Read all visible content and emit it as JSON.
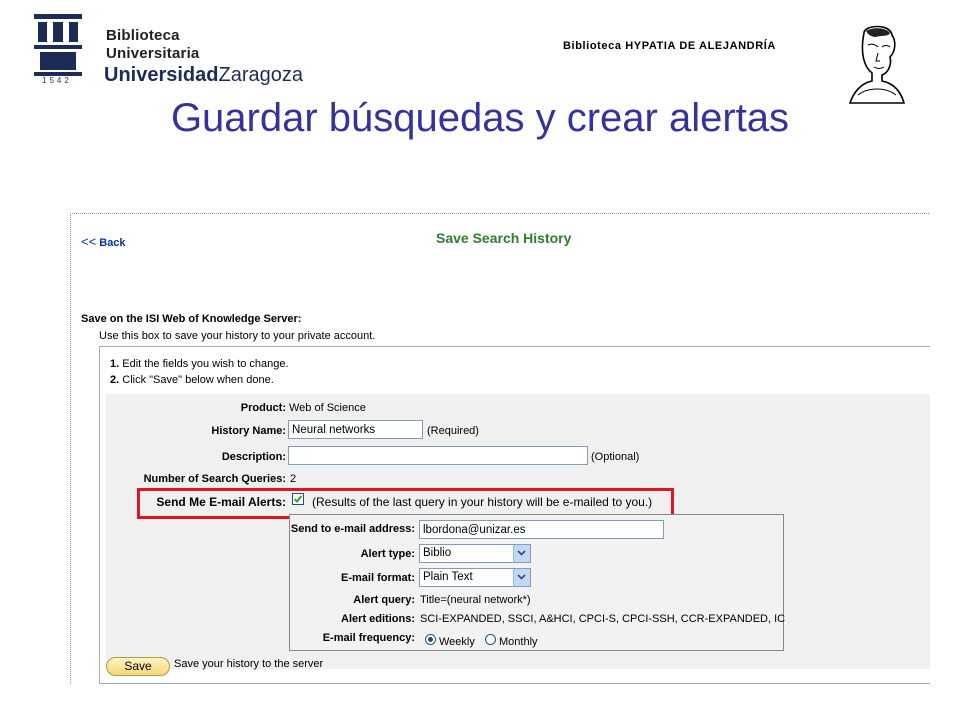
{
  "header": {
    "logo_line1": "Biblioteca",
    "logo_line2": "Universitaria",
    "logo_line3_bold": "Universidad",
    "logo_line3_rest": "Zaragoza",
    "logo_year": "1542",
    "library_name": "Biblioteca HYPATIA DE ALEJANDRÍA",
    "portrait_icon": "hypatia-portrait-icon"
  },
  "slide_title": "Guardar búsquedas y crear alertas",
  "panel": {
    "back_arrows": "<<",
    "back_label": "Back",
    "heading": "Save Search History",
    "save_on_label": "Save on the ISI Web of Knowledge Server:",
    "use_box_text": "Use this box to save your history to your private account.",
    "instruction_1_num": "1.",
    "instruction_1": "Edit the fields you wish to change.",
    "instruction_2_num": "2.",
    "instruction_2": "Click \"Save\" below when done."
  },
  "form": {
    "product_label": "Product:",
    "product_value": "Web of Science",
    "history_name_label": "History Name:",
    "history_name_value": "Neural networks",
    "history_name_note": "(Required)",
    "description_label": "Description:",
    "description_value": "",
    "description_note": "(Optional)",
    "num_queries_label": "Number of Search Queries:",
    "num_queries_value": "2",
    "alerts_label": "Send Me E-mail Alerts:",
    "alerts_checked": true,
    "alerts_note": "(Results of the last query in your history will be e-mailed to you.)"
  },
  "alert": {
    "email_label": "Send to e-mail address:",
    "email_value": "lbordona@unizar.es",
    "type_label": "Alert type:",
    "type_value": "Biblio",
    "format_label": "E-mail format:",
    "format_value": "Plain Text",
    "query_label": "Alert query:",
    "query_value": "Title=(neural network*)",
    "editions_label": "Alert editions:",
    "editions_value": "SCI-EXPANDED, SSCI, A&HCI, CPCI-S, CPCI-SSH, CCR-EXPANDED, IC",
    "frequency_label": "E-mail frequency:",
    "frequency_weekly": "Weekly",
    "frequency_monthly": "Monthly",
    "frequency_selected": "Weekly"
  },
  "footer": {
    "save_button": "Save",
    "save_desc": "Save your history to the server"
  },
  "colors": {
    "title": "#33339a",
    "heading_green": "#2e7d2e",
    "link_blue": "#0033aa",
    "highlight_red": "#e0161e"
  }
}
